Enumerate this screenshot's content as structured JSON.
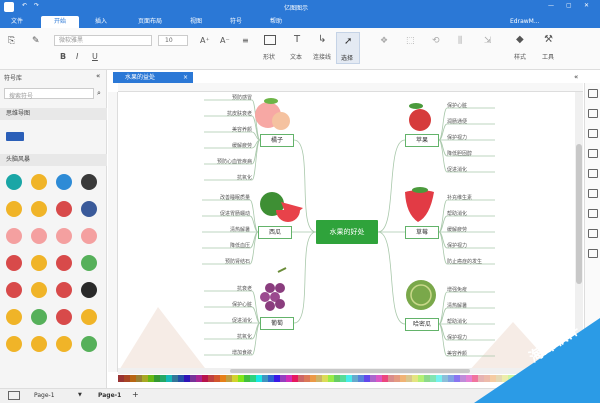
{
  "app": {
    "title": "亿图图示",
    "user": "EdrawM...",
    "brand_color": "#2b78d6"
  },
  "menu_tabs": [
    "文件",
    "开始",
    "插入",
    "页面布局",
    "视图",
    "符号",
    "帮助"
  ],
  "active_tab": "开始",
  "toolbar": {
    "font_placeholder": "微软雅黑",
    "font_size": "10",
    "tools": [
      "形状",
      "文本",
      "连接线",
      "选择",
      "样式",
      "工具"
    ]
  },
  "sidebar": {
    "title": "符号库",
    "search_placeholder": "搜索符号",
    "sections": [
      "思维导图",
      "头脑风暴"
    ]
  },
  "document": {
    "tab_name": "水果的益处"
  },
  "mindmap": {
    "center": "水果的好处",
    "branches": [
      {
        "name": "橘子",
        "leaves": [
          "预防感冒",
          "抗皮肤衰老",
          "美容养颜",
          "缓解疲劳",
          "预防心血管疾病",
          "抗氧化"
        ]
      },
      {
        "name": "西瓜",
        "leaves": [
          "改善睡眠质量",
          "促进胃肠蠕动",
          "清热解暑",
          "降低血压",
          "预防肾结石"
        ]
      },
      {
        "name": "葡萄",
        "leaves": [
          "抗衰老",
          "保护心脏",
          "促进消化",
          "抗氧化",
          "增加食欲"
        ]
      },
      {
        "name": "苹果",
        "leaves": [
          "保护心脏",
          "润肠通便",
          "保护视力",
          "降低胆固醇",
          "促进消化"
        ]
      },
      {
        "name": "草莓",
        "leaves": [
          "补充维生素",
          "帮助消化",
          "缓解疲劳",
          "保护视力",
          "防止癌症的发生"
        ]
      },
      {
        "name": "哈密瓜",
        "leaves": [
          "增强免疫",
          "清热解暑",
          "帮助消化",
          "保护视力",
          "美容养颜"
        ]
      }
    ]
  },
  "pages": [
    "Page-1",
    "Page-1"
  ],
  "watermark": "海绵软件"
}
